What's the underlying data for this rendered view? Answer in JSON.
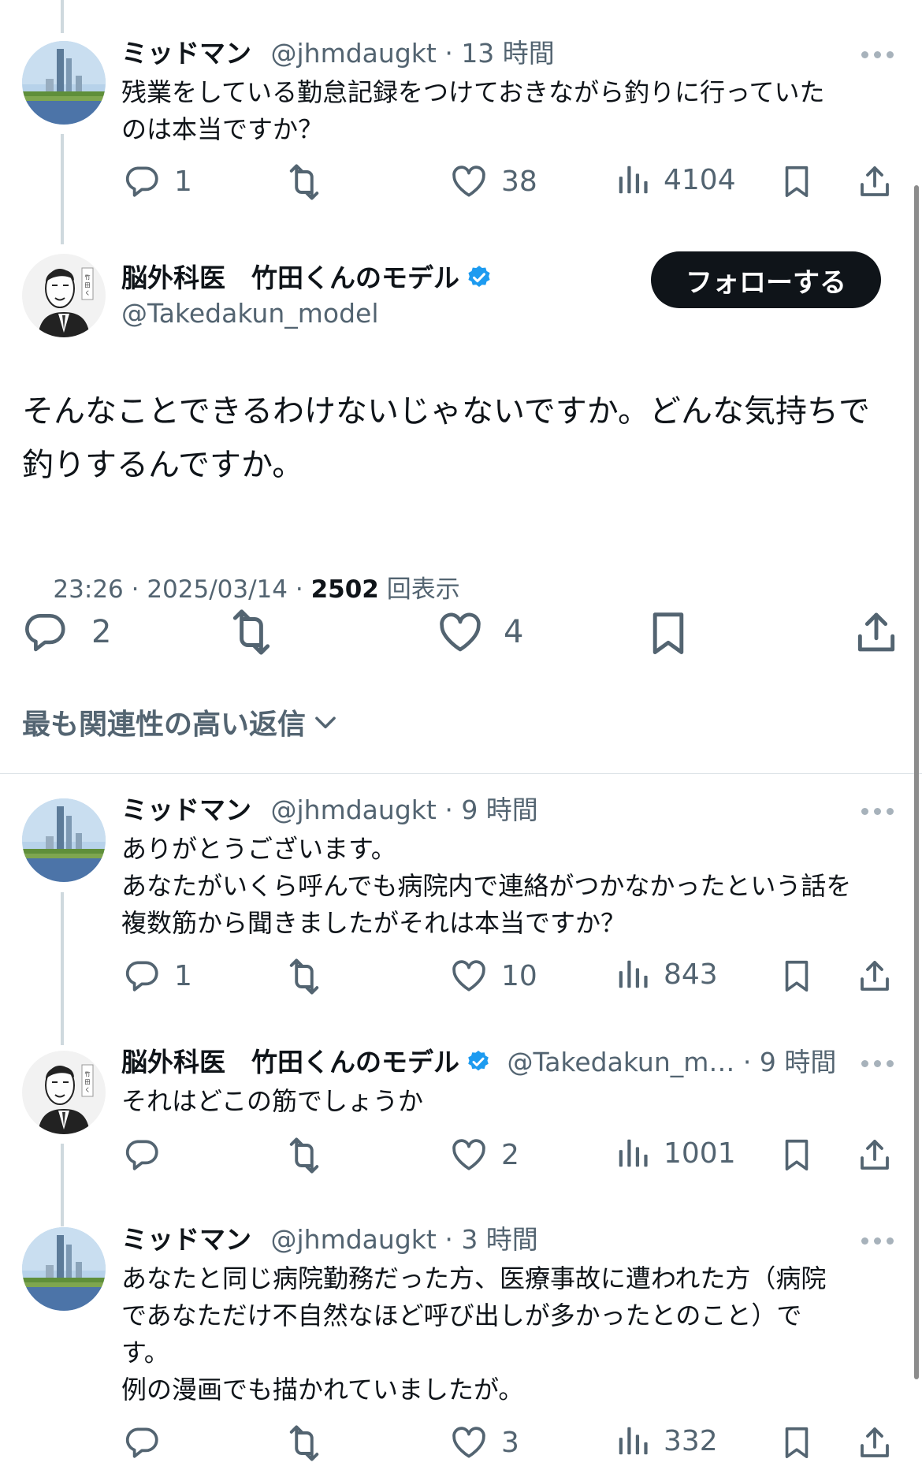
{
  "posts": [
    {
      "name": "ミッドマン",
      "handle": "@jhmdaugkt",
      "sep": "·",
      "time": "13 時間",
      "text": "残業をしている勤怠記録をつけておきながら釣りに行っていた\nのは本当ですか？",
      "replies": "1",
      "retweets": "",
      "likes": "38",
      "views": "4104"
    },
    {
      "name": "ミッドマン",
      "handle": "@jhmdaugkt",
      "sep": "·",
      "time": "9 時間",
      "text": "ありがとうございます。\nあなたがいくら呼んでも病院内で連絡がつかなかったという話を\n複数筋から聞きましたがそれは本当ですか？",
      "replies": "1",
      "retweets": "",
      "likes": "10",
      "views": "843"
    },
    {
      "name": "脳外科医　竹田くんのモデル",
      "handle": "@Takedakun_m…",
      "sep": "·",
      "time": "9 時間",
      "text": "それはどこの筋でしょうか",
      "replies": "",
      "retweets": "",
      "likes": "2",
      "views": "1001"
    },
    {
      "name": "ミッドマン",
      "handle": "@jhmdaugkt",
      "sep": "·",
      "time": "3 時間",
      "text": "あなたと同じ病院勤務だった方、医療事故に遭われた方（病院\nであなただけ不自然なほど呼び出しが多かったとのこと）で\nす。\n例の漫画でも描かれていましたが。",
      "replies": "",
      "retweets": "",
      "likes": "3",
      "views": "332"
    }
  ],
  "main": {
    "name": "脳外科医　竹田くんのモデル",
    "handle": "@Takedakun_model",
    "follow_label": "フォローする",
    "text": "そんなことできるわけないじゃないですか。どんな気持ちで\n釣りするんですか。",
    "meta_time": "23:26 · 2025/03/14 · ",
    "meta_views": "2502",
    "meta_views_label": " 回表示",
    "replies": "2",
    "retweets": "",
    "likes": "4",
    "sort_label": "最も関連性の高い返信"
  },
  "colors": {
    "text": "#0f1419",
    "secondary": "#536471",
    "verified": "#1d9bf0",
    "follow_bg": "#0f1419",
    "thread_line": "#cfd9de"
  },
  "icons": [
    "reply-icon",
    "retweet-icon",
    "like-icon",
    "views-icon",
    "bookmark-icon",
    "share-icon",
    "more-icon",
    "verified-badge-icon",
    "chevron-down-icon"
  ]
}
